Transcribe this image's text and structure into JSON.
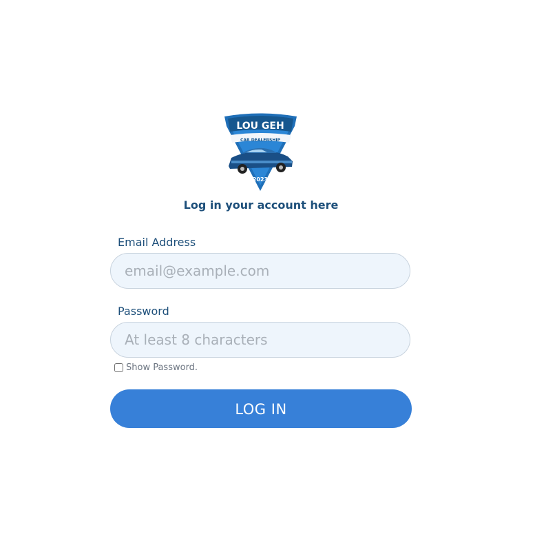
{
  "logo": {
    "brand": "LOU GEH",
    "subtitle": "CAR DEALERSHIP",
    "year": "2023"
  },
  "heading": "Log in your account here",
  "email": {
    "label": "Email Address",
    "placeholder": "email@example.com",
    "value": ""
  },
  "password": {
    "label": "Password",
    "placeholder": "At least 8 characters",
    "value": ""
  },
  "show_password": {
    "label": "Show Password.",
    "checked": false
  },
  "login_button": "LOG IN",
  "colors": {
    "accent": "#3780d8",
    "heading": "#1d4f7a",
    "field_bg": "#eef5fc"
  }
}
